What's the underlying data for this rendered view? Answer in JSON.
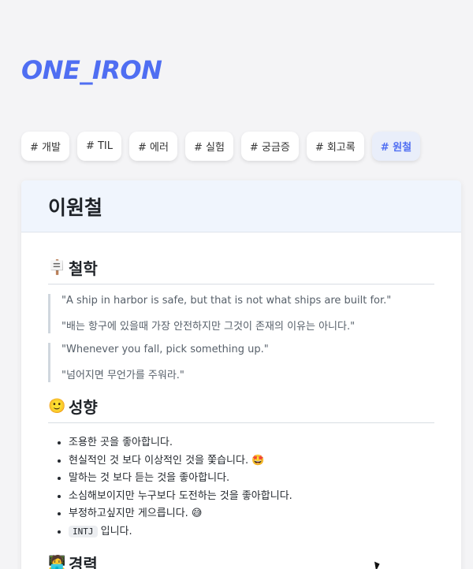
{
  "brand": {
    "logo": "ONE_IRON",
    "accent": "#4f6ef2"
  },
  "tags": [
    {
      "label": "# 개발",
      "active": false
    },
    {
      "label": "# TIL",
      "active": false
    },
    {
      "label": "# 에러",
      "active": false
    },
    {
      "label": "# 실험",
      "active": false
    },
    {
      "label": "# 궁금증",
      "active": false
    },
    {
      "label": "# 회고록",
      "active": false
    },
    {
      "label": "# 원철",
      "active": true
    }
  ],
  "post": {
    "title": "이원철",
    "philosophy": {
      "icon": "signpost-icon",
      "title": "철학",
      "quotes": [
        [
          "\"A ship in harbor is safe, but that is not what ships are built for.\"",
          "\"배는 항구에 있을때 가장 안전하지만 그것이 존재의 이유는 아니다.\""
        ],
        [
          "\"Whenever you fall, pick something up.\"",
          "\"넘어지면 무언가를 주워라.\""
        ]
      ]
    },
    "personality": {
      "icon": "smiling-face-icon",
      "title": "성향",
      "items": [
        "조용한 곳을 좋아합니다.",
        "현실적인 것 보다 이상적인 것을 쫓습니다. 🤩",
        "말하는 것 보다 듣는 것을 좋아합니다.",
        "소심해보이지만 누구보다 도전하는 것을 좋아합니다.",
        "부정하고싶지만 게으릅니다. 😅"
      ],
      "mbti_code": "INTJ",
      "mbti_suffix": " 입니다."
    },
    "career": {
      "icon": "person-icon",
      "title": "경력"
    }
  }
}
